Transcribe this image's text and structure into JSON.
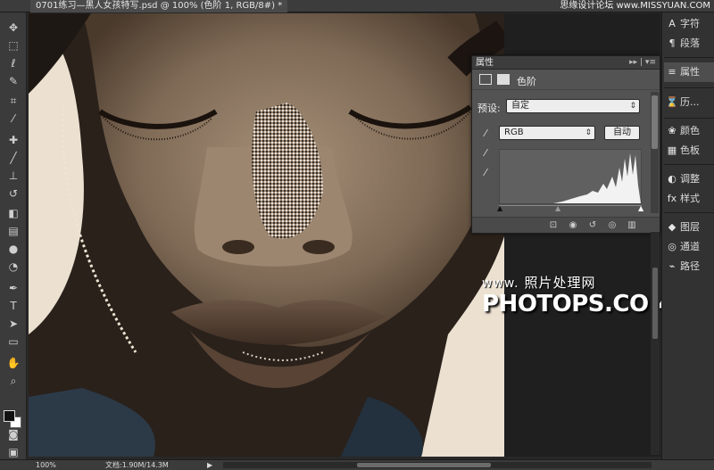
{
  "document": {
    "tab_title": "0701练习—黑人女孩特写.psd @ 100% (色阶 1, RGB/8#) *",
    "top_watermark": "思缘设计论坛 www.MISSYUAN.COM"
  },
  "tools": {
    "icons": [
      "move-tool-icon",
      "marquee-tool-icon",
      "lasso-tool-icon",
      "quick-select-tool-icon",
      "crop-tool-icon",
      "eyedropper-tool-icon",
      "healing-brush-icon",
      "brush-tool-icon",
      "clone-stamp-icon",
      "history-brush-icon",
      "eraser-tool-icon",
      "gradient-tool-icon",
      "blur-tool-icon",
      "dodge-tool-icon",
      "pen-tool-icon",
      "type-tool-icon",
      "path-select-icon",
      "shape-tool-icon",
      "hand-tool-icon",
      "zoom-tool-icon"
    ]
  },
  "properties_panel": {
    "tab_label": "属性",
    "menu_glyph": "▸▸ | ▾≡",
    "adjustment_label": "色阶",
    "preset_label": "预设:",
    "preset_value": "自定",
    "channel_value": "RGB",
    "auto_button": "自动"
  },
  "dock": {
    "items": [
      {
        "icon": "A",
        "label": "字符"
      },
      {
        "icon": "¶",
        "label": "段落"
      },
      {
        "icon": "≡",
        "label": "属性"
      },
      {
        "icon": "⌛",
        "label": "历..."
      },
      {
        "icon": "❀",
        "label": "颜色"
      },
      {
        "icon": "▦",
        "label": "色板"
      },
      {
        "icon": "◐",
        "label": "调整"
      },
      {
        "icon": "fx",
        "label": "样式"
      },
      {
        "icon": "◆",
        "label": "图层"
      },
      {
        "icon": "◎",
        "label": "通道"
      },
      {
        "icon": "⌁",
        "label": "路径"
      }
    ]
  },
  "status_bar": {
    "zoom": "100%",
    "doc_info": "文档:1.90M/14.3M",
    "arrow": "▶"
  },
  "overlay_watermark": {
    "line1_url": "www.",
    "line1_cn": "照片处理网",
    "line2": "PHOTOPS.COM"
  }
}
